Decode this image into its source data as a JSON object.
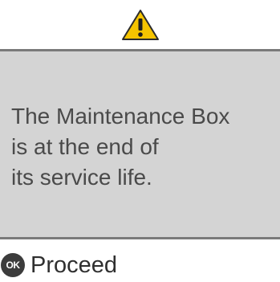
{
  "header": {
    "icon": "warning-icon",
    "icon_color": "#f5c400"
  },
  "message": {
    "text": "The Maintenance Box\nis at the end of\nits service life."
  },
  "footer": {
    "ok_icon_label": "OK",
    "proceed_label": "Proceed"
  },
  "colors": {
    "panel_background": "#d4d4d4",
    "panel_border": "#7a7a7a",
    "text": "#4a4a4a"
  }
}
